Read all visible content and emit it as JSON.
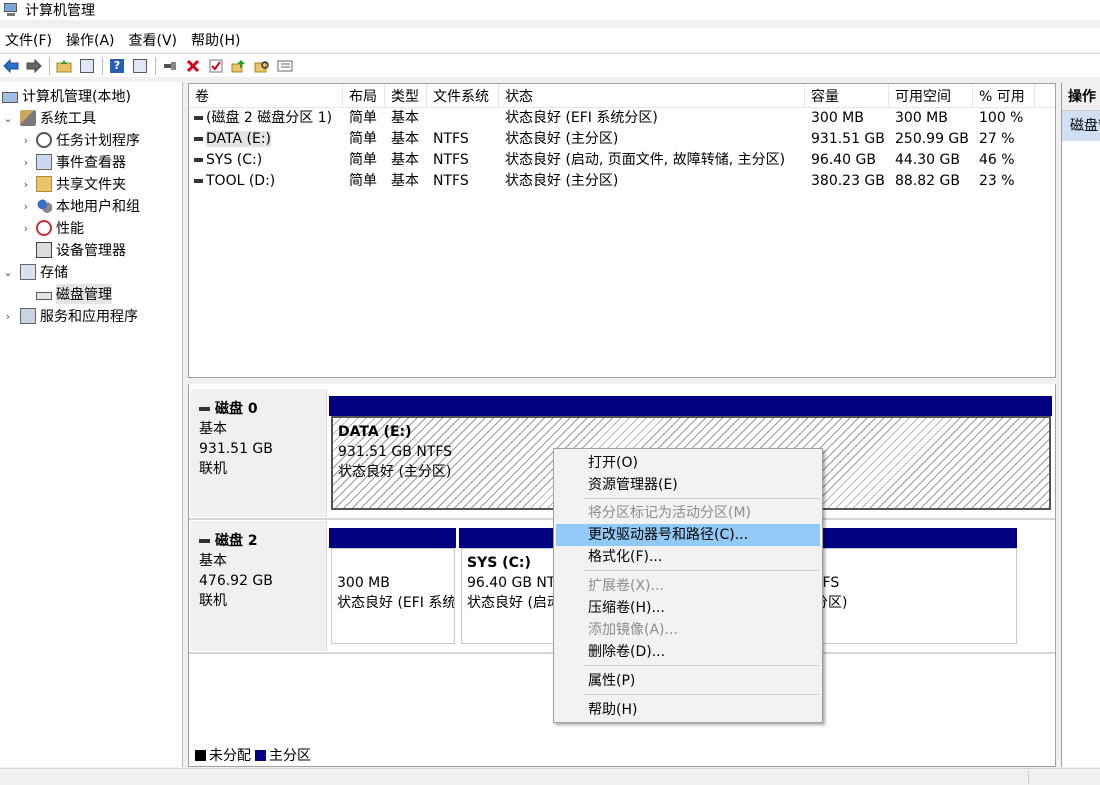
{
  "window": {
    "title": "计算机管理"
  },
  "menubar": [
    {
      "label": "文件(F)"
    },
    {
      "label": "操作(A)"
    },
    {
      "label": "查看(V)"
    },
    {
      "label": "帮助(H)"
    }
  ],
  "toolbar": [
    {
      "icon": "back-arrow-icon"
    },
    {
      "icon": "forward-arrow-icon"
    },
    {
      "icon": "up-folder-icon"
    },
    {
      "icon": "show-hide-tree-icon"
    },
    {
      "icon": "help-icon"
    },
    {
      "icon": "show-hide-action-pane-icon"
    },
    {
      "icon": "connect-icon"
    },
    {
      "icon": "delete-icon"
    },
    {
      "icon": "properties-check-icon"
    },
    {
      "icon": "export-icon"
    },
    {
      "icon": "search-folder-icon"
    },
    {
      "icon": "list-view-icon"
    }
  ],
  "tree": {
    "root": "计算机管理(本地)",
    "system_tools": "系统工具",
    "task_scheduler": "任务计划程序",
    "event_viewer": "事件查看器",
    "shared_folders": "共享文件夹",
    "local_users": "本地用户和组",
    "performance": "性能",
    "device_manager": "设备管理器",
    "storage": "存储",
    "disk_management": "磁盘管理",
    "services_apps": "服务和应用程序"
  },
  "volume_list": {
    "columns": [
      "卷",
      "布局",
      "类型",
      "文件系统",
      "状态",
      "容量",
      "可用空间",
      "% 可用"
    ],
    "rows": [
      {
        "volume": "(磁盘 2 磁盘分区 1)",
        "layout": "简单",
        "type": "基本",
        "fs": "",
        "status": "状态良好 (EFI 系统分区)",
        "capacity": "300 MB",
        "free": "300 MB",
        "pct": "100 %"
      },
      {
        "volume": "DATA (E:)",
        "layout": "简单",
        "type": "基本",
        "fs": "NTFS",
        "status": "状态良好 (主分区)",
        "capacity": "931.51 GB",
        "free": "250.99 GB",
        "pct": "27 %"
      },
      {
        "volume": "SYS (C:)",
        "layout": "简单",
        "type": "基本",
        "fs": "NTFS",
        "status": "状态良好 (启动, 页面文件, 故障转储, 主分区)",
        "capacity": "96.40 GB",
        "free": "44.30 GB",
        "pct": "46 %"
      },
      {
        "volume": "TOOL (D:)",
        "layout": "简单",
        "type": "基本",
        "fs": "NTFS",
        "status": "状态良好 (主分区)",
        "capacity": "380.23 GB",
        "free": "88.82 GB",
        "pct": "23 %"
      }
    ]
  },
  "disks": [
    {
      "name": "磁盘 0",
      "type": "基本",
      "size": "931.51 GB",
      "state": "联机",
      "partitions": [
        {
          "name": "DATA  (E:)",
          "size": "931.51 GB NTFS",
          "status": "状态良好 (主分区)"
        }
      ]
    },
    {
      "name": "磁盘 2",
      "type": "基本",
      "size": "476.92 GB",
      "state": "联机",
      "partitions": [
        {
          "name": "",
          "size": "300 MB",
          "status": "状态良好 (EFI 系统"
        },
        {
          "name": "SYS  (C:)",
          "size": "96.40 GB NT",
          "status": "状态良好 (启动"
        },
        {
          "name": "",
          "size": "TFS",
          "status": "分区)"
        }
      ]
    }
  ],
  "legend": [
    {
      "label": "未分配",
      "color": "#000000"
    },
    {
      "label": "主分区",
      "color": "#000080"
    }
  ],
  "actions": {
    "header": "操作",
    "item": "磁盘管理"
  },
  "context_menu": [
    {
      "label": "打开(O)",
      "enabled": true
    },
    {
      "label": "资源管理器(E)",
      "enabled": true
    },
    {
      "label": "将分区标记为活动分区(M)",
      "enabled": false
    },
    {
      "label": "更改驱动器号和路径(C)...",
      "enabled": true,
      "highlighted": true
    },
    {
      "label": "格式化(F)...",
      "enabled": true
    },
    {
      "label": "扩展卷(X)...",
      "enabled": false
    },
    {
      "label": "压缩卷(H)...",
      "enabled": true
    },
    {
      "label": "添加镜像(A)...",
      "enabled": false
    },
    {
      "label": "删除卷(D)...",
      "enabled": true
    },
    {
      "label": "属性(P)",
      "enabled": true
    },
    {
      "label": "帮助(H)",
      "enabled": true
    }
  ],
  "colors": {
    "primary_partition": "#000080",
    "menu_highlight": "#91c9f7",
    "selection": "#e5e5e5"
  }
}
